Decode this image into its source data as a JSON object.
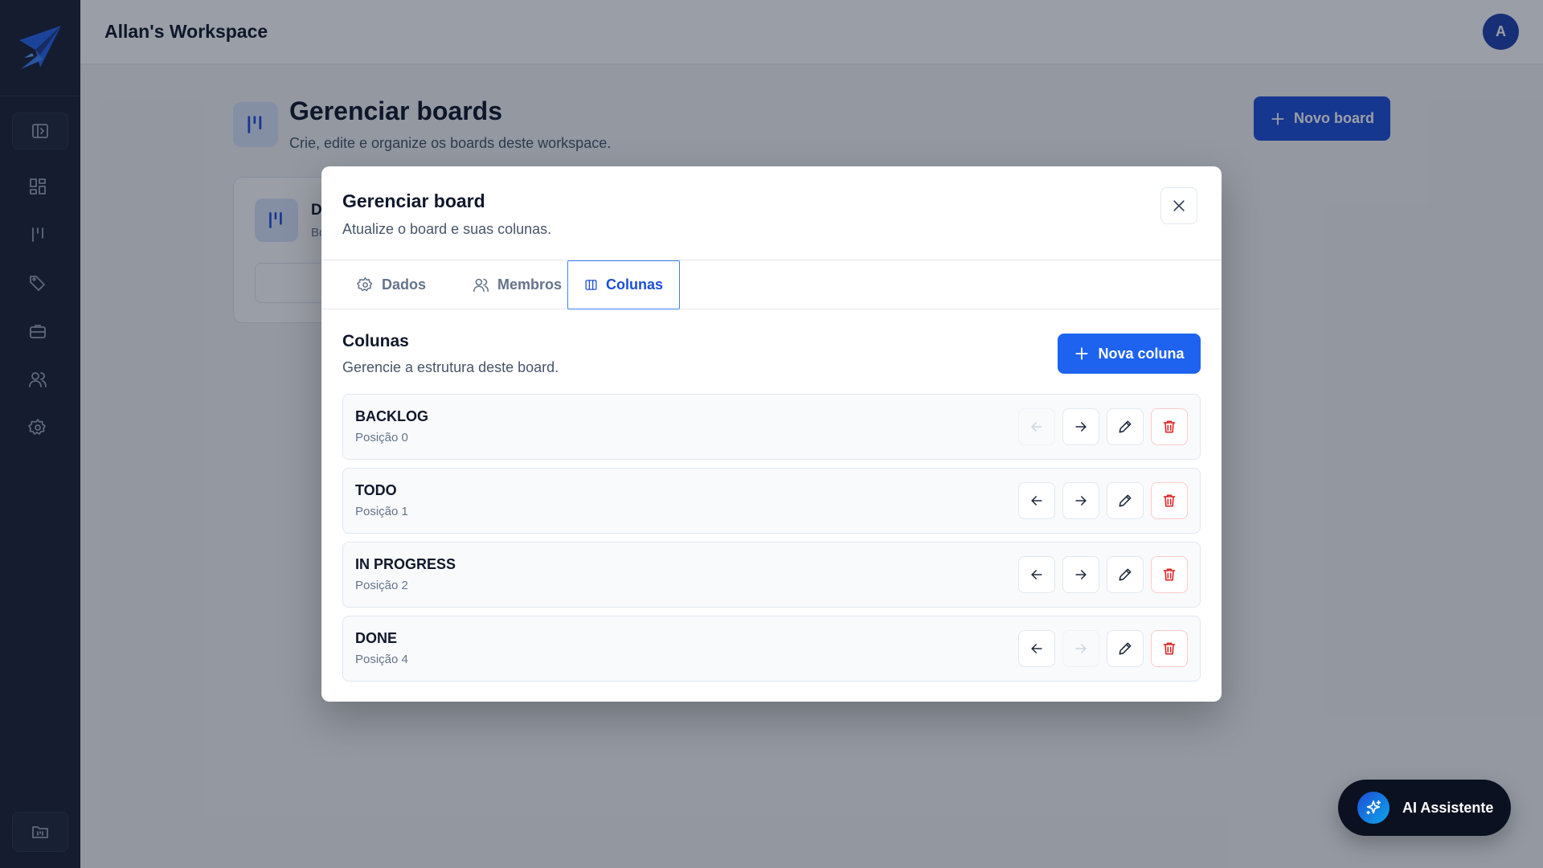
{
  "header": {
    "workspace_title": "Allan's Workspace",
    "avatar_initial": "A"
  },
  "page": {
    "title": "Gerenciar boards",
    "subtitle": "Crie, edite e organize os boards deste workspace.",
    "new_board_label": "Novo board",
    "board_card": {
      "name_initial": "D",
      "desc_initial": "Bo"
    }
  },
  "modal": {
    "title": "Gerenciar board",
    "subtitle": "Atualize o board e suas colunas.",
    "tabs": [
      {
        "label": "Dados",
        "icon": "gear-icon"
      },
      {
        "label": "Membros",
        "icon": "users-icon"
      },
      {
        "label": "Colunas",
        "icon": "columns-icon",
        "active": true
      }
    ],
    "section": {
      "title": "Colunas",
      "subtitle": "Gerencie a estrutura deste board.",
      "new_column_label": "Nova coluna"
    },
    "columns": [
      {
        "name": "BACKLOG",
        "position": "Posição 0",
        "can_move_left": false,
        "can_move_right": true
      },
      {
        "name": "TODO",
        "position": "Posição 1",
        "can_move_left": true,
        "can_move_right": true
      },
      {
        "name": "IN PROGRESS",
        "position": "Posição 2",
        "can_move_left": true,
        "can_move_right": true
      },
      {
        "name": "DONE",
        "position": "Posição 4",
        "can_move_left": true,
        "can_move_right": false
      }
    ]
  },
  "assistant": {
    "label": "AI Assistente"
  },
  "colors": {
    "sidebar": "#1a2035",
    "primary": "#1d4ed8",
    "danger": "#dc2626"
  }
}
